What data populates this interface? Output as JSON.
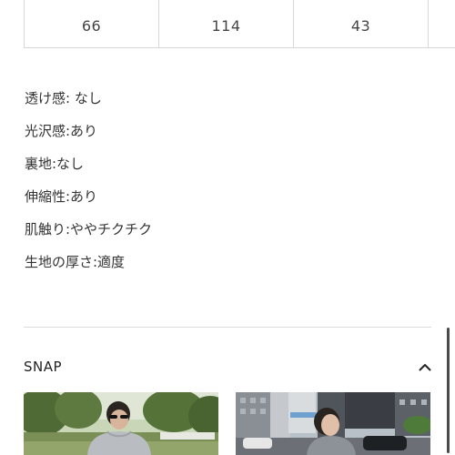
{
  "size_table": {
    "visible_row": [
      "66",
      "114",
      "43",
      ""
    ]
  },
  "attributes": [
    "透け感: なし",
    "光沢感:あり",
    "裏地:なし",
    "伸縮性:あり",
    "肌触り:ややチクチク",
    "生地の厚さ:適度"
  ],
  "snap": {
    "title": "SNAP",
    "toggle_icon": "chevron-up-icon",
    "photos": [
      {
        "icon": "snap-photo-park"
      },
      {
        "icon": "snap-photo-city"
      }
    ]
  },
  "colors": {
    "border": "#d8d8d8",
    "text": "#333333",
    "scrollbar": "#4a4a4a"
  }
}
